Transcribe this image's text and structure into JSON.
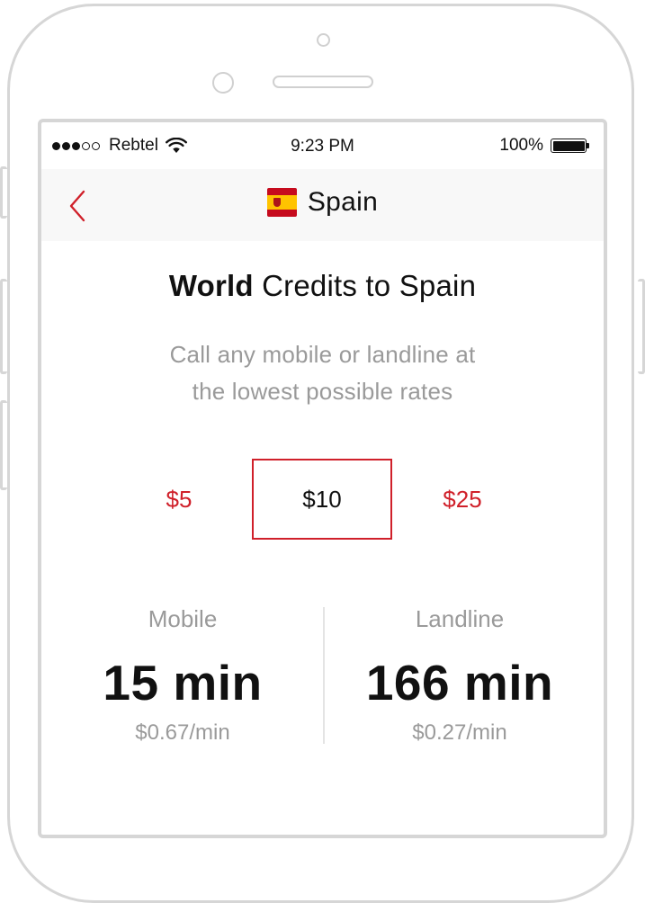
{
  "status_bar": {
    "carrier": "Rebtel",
    "time": "9:23 PM",
    "battery": "100%",
    "signal_dots_full": 3,
    "signal_dots_empty": 2
  },
  "nav": {
    "title": "Spain",
    "back_icon": "chevron-left-icon",
    "flag_icon": "spain-flag-icon"
  },
  "headline": {
    "bold": "World",
    "rest": " Credits to Spain"
  },
  "subtitle": {
    "line1": "Call any mobile or landline at",
    "line2": "the lowest possible rates"
  },
  "amounts": [
    {
      "label": "$5",
      "selected": false
    },
    {
      "label": "$10",
      "selected": true
    },
    {
      "label": "$25",
      "selected": false
    }
  ],
  "rates": {
    "mobile": {
      "label": "Mobile",
      "minutes": "15 min",
      "price": "$0.67/min"
    },
    "landline": {
      "label": "Landline",
      "minutes": "166 min",
      "price": "$0.27/min"
    }
  },
  "colors": {
    "accent": "#d0202a",
    "muted_text": "#9a9a9a",
    "frame": "#d6d6d6"
  }
}
